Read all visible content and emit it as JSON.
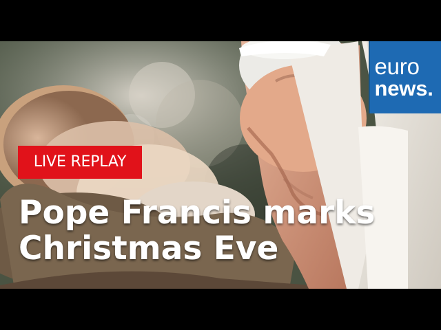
{
  "brand": {
    "name_line_1": "euro",
    "name_line_2": "news."
  },
  "badge": {
    "label": "LIVE REPLAY",
    "color": "#e1121a"
  },
  "headline": {
    "line_1": "Pope Francis marks",
    "line_2": "Christmas Eve"
  },
  "colors": {
    "brand_blue": "#1e6ab3",
    "text": "#ffffff",
    "letterbox": "#000000"
  }
}
